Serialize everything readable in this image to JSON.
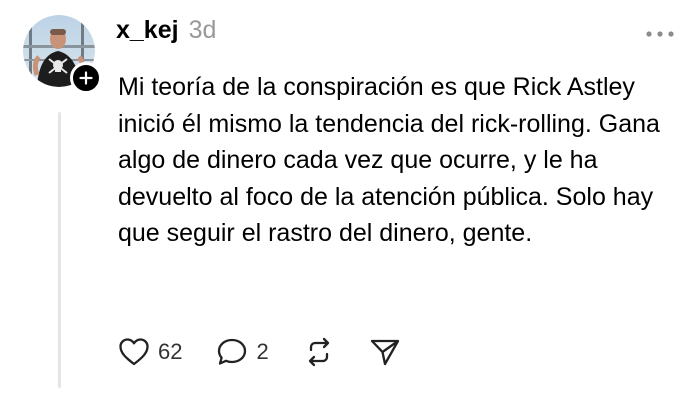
{
  "post": {
    "username": "x_kej",
    "timestamp": "3d",
    "text": "Mi teoría de la conspiración es que Rick Astley inició él mismo la tendencia del rick-rolling. Gana algo de dinero cada vez que ocurre, y le ha devuelto al foco de la atención pública. Solo hay que seguir el rastro del dinero, gente.",
    "likes": "62",
    "replies": "2"
  },
  "icons": {
    "avatar": "user-avatar-photo",
    "follow": "plus-icon",
    "more": "more-dots-icon",
    "like": "heart-icon",
    "reply": "comment-bubble-icon",
    "repost": "repost-icon",
    "share": "send-icon"
  },
  "colors": {
    "text": "#000000",
    "muted": "#999999",
    "icon": "#222222",
    "thread_line": "#e5e5e5"
  }
}
